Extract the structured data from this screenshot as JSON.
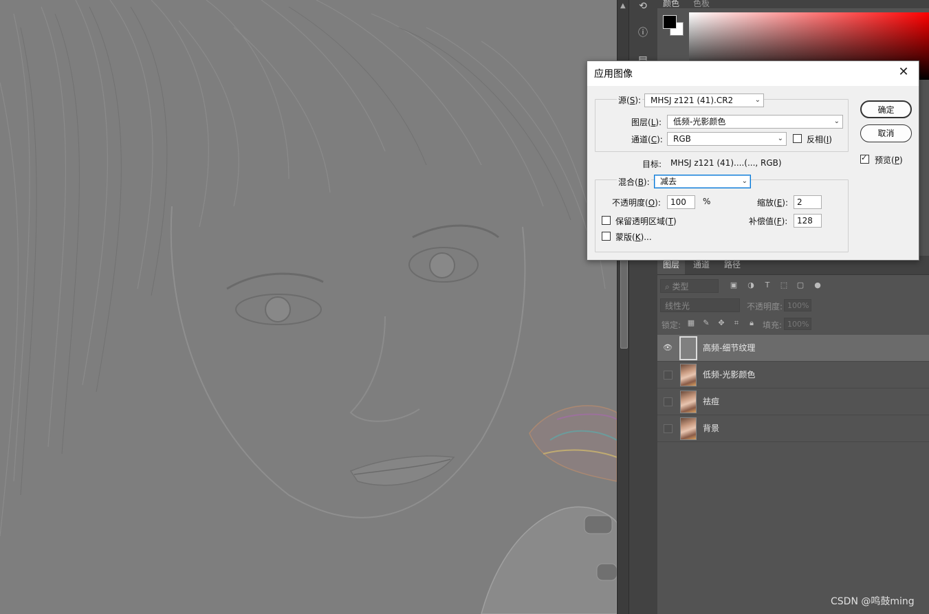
{
  "dialog": {
    "title": "应用图像",
    "source_label_pre": "源(",
    "source_key": "S",
    "source_label_post": "):",
    "source_value": "MHSJ z121 (41).CR2",
    "layer_label_pre": "图层(",
    "layer_key": "L",
    "layer_label_post": "):",
    "layer_value": "低频-光影颜色",
    "channel_label_pre": "通道(",
    "channel_key": "C",
    "channel_label_post": "):",
    "channel_value": "RGB",
    "invert_label_pre": "反相(",
    "invert_key": "I",
    "invert_label_post": ")",
    "target_label": "目标:",
    "target_value": "MHSJ z121 (41)....(..., RGB)",
    "blend_label_pre": "混合(",
    "blend_key": "B",
    "blend_label_post": "):",
    "blend_value": "减去",
    "opacity_label_pre": "不透明度(",
    "opacity_key": "O",
    "opacity_label_post": "):",
    "opacity_value": "100",
    "opacity_unit": "%",
    "scale_label_pre": "缩放(",
    "scale_key": "E",
    "scale_label_post": "):",
    "scale_value": "2",
    "offset_label_pre": "补偿值(",
    "offset_key": "F",
    "offset_label_post": "):",
    "offset_value": "128",
    "preserve_label_pre": "保留透明区域(",
    "preserve_key": "T",
    "preserve_label_post": ")",
    "mask_label_pre": "蒙版(",
    "mask_key": "K",
    "mask_label_post": ")...",
    "ok_label": "确定",
    "cancel_label": "取消",
    "preview_label_pre": "预览(",
    "preview_key": "P",
    "preview_label_post": ")"
  },
  "color_panel": {
    "tab1": "颜色",
    "tab2": "色板",
    "foreground": "#000000",
    "background": "#ffffff"
  },
  "layers_panel": {
    "tabs": [
      "图层",
      "通道",
      "路径"
    ],
    "filter_placeholder": "类型",
    "blend_mode": "线性光",
    "opacity_label": "不透明度:",
    "opacity_value": "100%",
    "lock_label": "锁定:",
    "fill_label": "填充:",
    "fill_value": "100%",
    "layers": [
      {
        "name": "高频-细节纹理",
        "visible": true,
        "selected": true
      },
      {
        "name": "低频-光影颜色",
        "visible": false,
        "selected": false
      },
      {
        "name": "祛痘",
        "visible": false,
        "selected": false
      },
      {
        "name": "背景",
        "visible": false,
        "selected": false
      }
    ]
  },
  "watermark": "CSDN @鸣鼓ming"
}
